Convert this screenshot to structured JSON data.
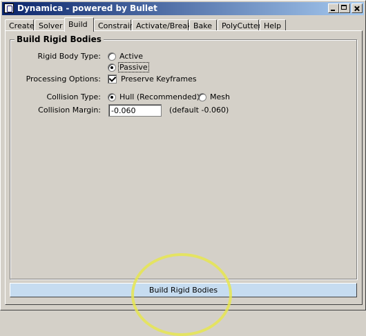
{
  "window": {
    "title": "Dynamica - powered by Bullet"
  },
  "tabs": [
    {
      "label": "Create"
    },
    {
      "label": "Solver"
    },
    {
      "label": "Build",
      "active": true
    },
    {
      "label": "Constrain"
    },
    {
      "label": "Activate/Break"
    },
    {
      "label": "Bake"
    },
    {
      "label": "PolyCutter"
    },
    {
      "label": "Help"
    }
  ],
  "section": {
    "title": "Build Rigid Bodies"
  },
  "rigid_body_type": {
    "label": "Rigid Body Type:",
    "options": [
      "Active",
      "Passive"
    ],
    "selected": "Passive"
  },
  "processing_options": {
    "label": "Processing Options:",
    "checkbox_label": "Preserve Keyframes",
    "checked": true
  },
  "collision_type": {
    "label": "Collision Type:",
    "options": [
      "Hull (Recommended)",
      "Mesh"
    ],
    "selected": "Hull (Recommended)"
  },
  "collision_margin": {
    "label": "Collision Margin:",
    "value": "-0.060",
    "default_note": "(default -0.060)"
  },
  "build_button": {
    "label": "Build Rigid Bodies"
  }
}
